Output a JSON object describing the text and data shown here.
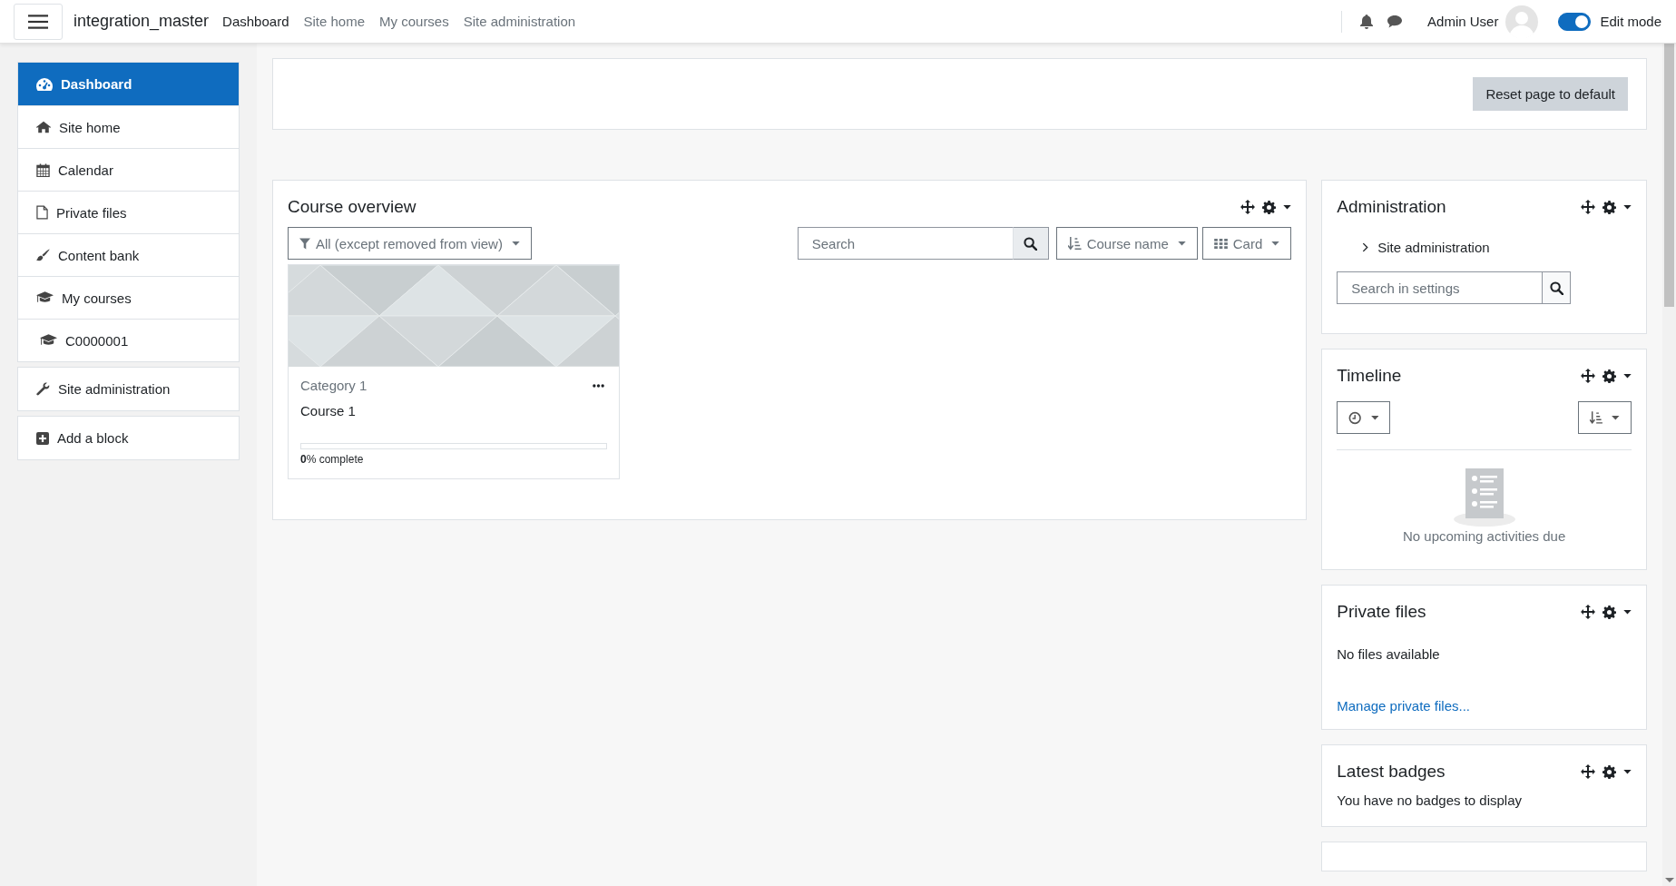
{
  "navbar": {
    "site_name": "integration_master",
    "links": [
      {
        "label": "Dashboard",
        "selected": true
      },
      {
        "label": "Site home",
        "selected": false
      },
      {
        "label": "My courses",
        "selected": false
      },
      {
        "label": "Site administration",
        "selected": false
      }
    ],
    "user_name": "Admin User",
    "edit_mode": {
      "label": "Edit mode",
      "on": true
    }
  },
  "sidebar": {
    "sections": [
      {
        "items": [
          {
            "label": "Dashboard",
            "selected": true
          },
          {
            "label": "Site home",
            "selected": false
          },
          {
            "label": "Calendar",
            "selected": false
          },
          {
            "label": "Private files",
            "selected": false
          },
          {
            "label": "Content bank",
            "selected": false
          },
          {
            "label": "My courses",
            "selected": false,
            "children": [
              {
                "label": "C0000001",
                "selected": false
              }
            ]
          }
        ]
      },
      {
        "items": [
          {
            "label": "Site administration",
            "selected": false
          }
        ]
      },
      {
        "items": [
          {
            "label": "Add a block",
            "selected": false
          }
        ]
      }
    ]
  },
  "reset_button": "Reset page to default",
  "course_overview": {
    "title": "Course overview",
    "filter": "All (except removed from view)",
    "search": {
      "placeholder": "Search"
    },
    "sort": "Course name",
    "view": "Card",
    "courses": [
      {
        "category": "Category 1",
        "name": "Course 1",
        "level": 0,
        "progress_text": "**0**% complete"
      }
    ]
  },
  "blocks": [
    {
      "kind": "admin",
      "title": "Administration",
      "tree": [
        {
          "label": "Site administration",
          "expanded": false
        }
      ],
      "search": {
        "placeholder": "Search in settings"
      }
    },
    {
      "kind": "timeline",
      "title": "Timeline",
      "empty_text": "No upcoming activities due"
    },
    {
      "kind": "files",
      "title": "Private files",
      "text": "No files available",
      "link": "Manage private files..."
    },
    {
      "kind": "text",
      "title": "Latest badges",
      "text": "You have no badges to display"
    },
    {
      "kind": "cut"
    }
  ]
}
